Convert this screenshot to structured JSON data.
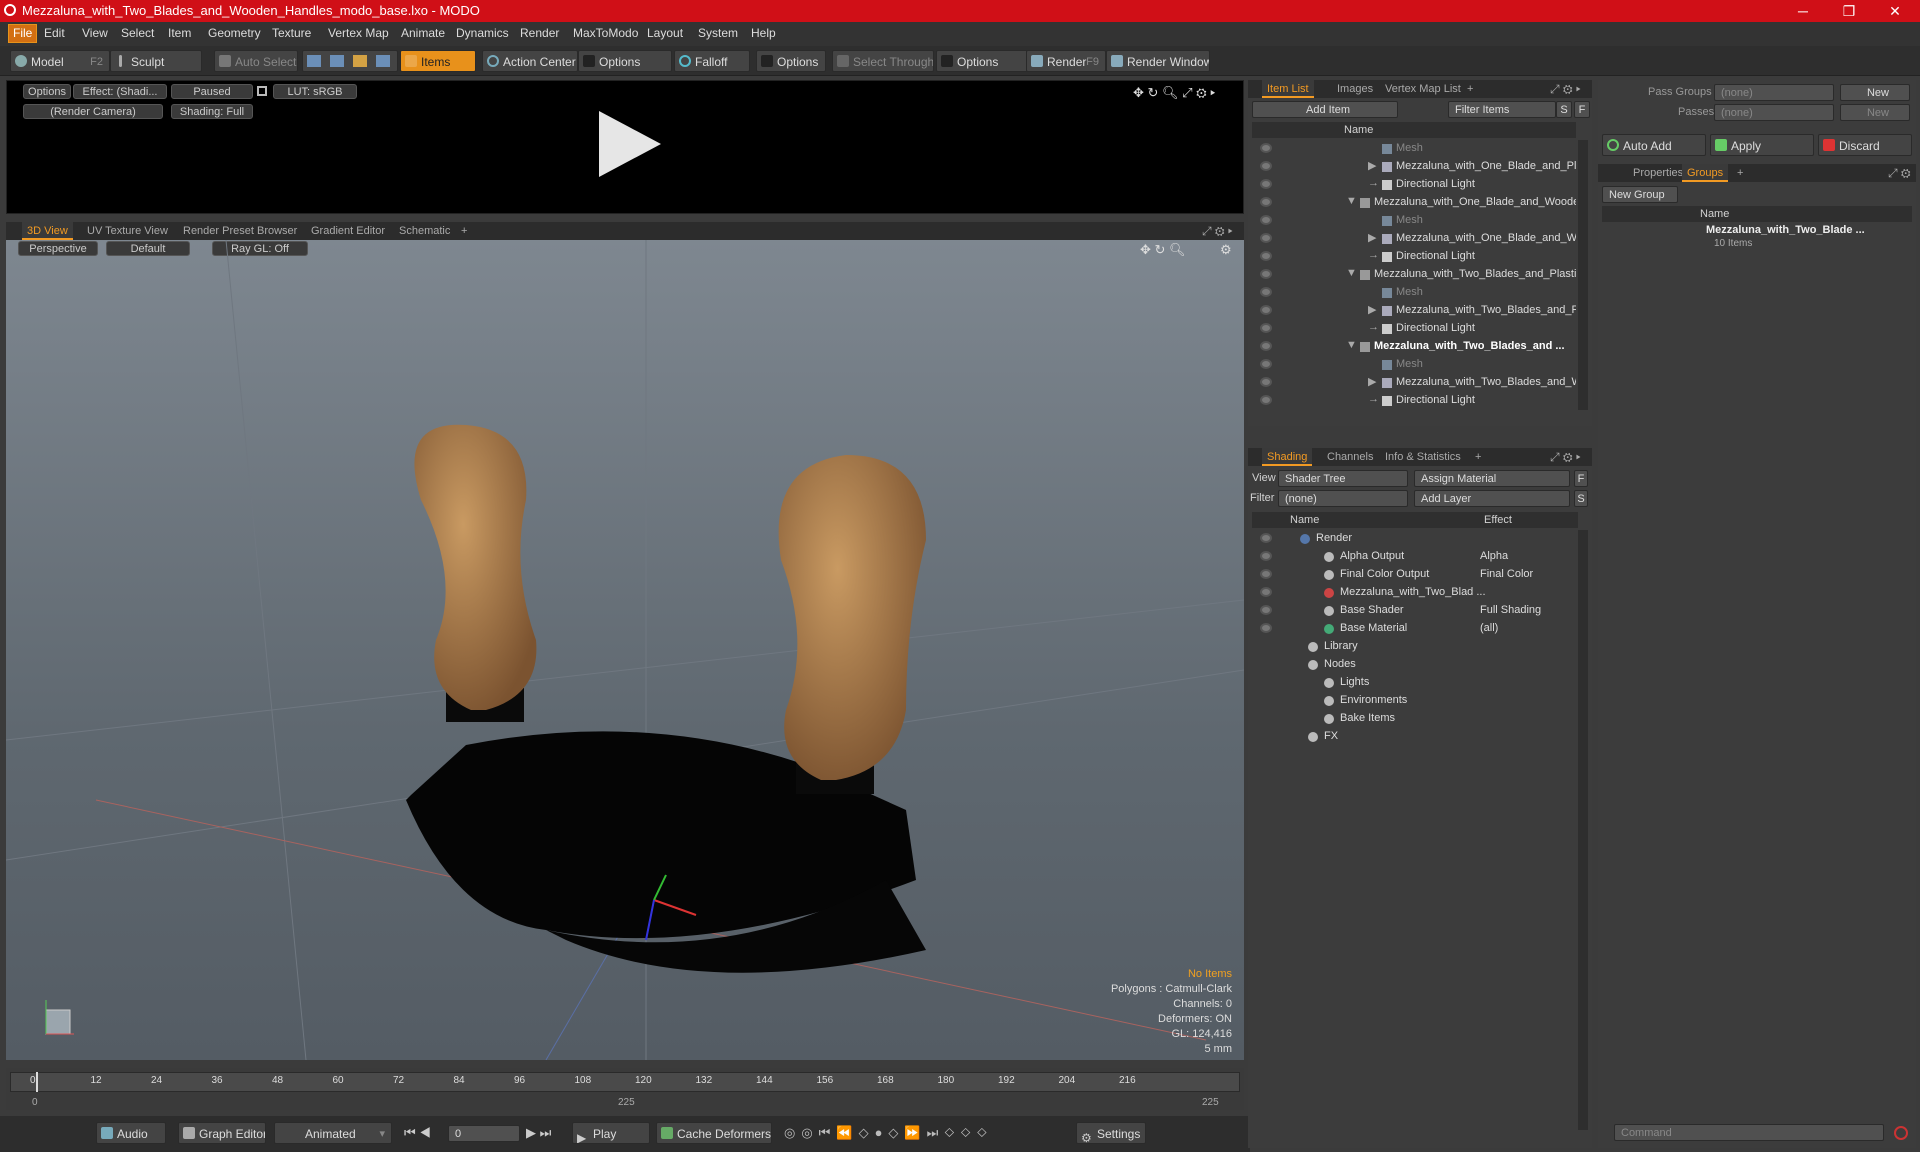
{
  "window": {
    "title": "Mezzaluna_with_Two_Blades_and_Wooden_Handles_modo_base.lxo - MODO",
    "minimize": "─",
    "maximize": "❐",
    "close": "✕"
  },
  "menus": [
    "File",
    "Edit",
    "View",
    "Select",
    "Item",
    "Geometry",
    "Texture",
    "Vertex Map",
    "Animate",
    "Dynamics",
    "Render",
    "MaxToModo",
    "Layout",
    "System",
    "Help"
  ],
  "toolbar": {
    "model": "Model",
    "model_key": "F2",
    "sculpt": "Sculpt",
    "auto_select": "Auto Select",
    "items": "Items",
    "action_center": "Action Center",
    "options1": "Options",
    "falloff": "Falloff",
    "options2": "Options",
    "select_through": "Select Through",
    "options3": "Options",
    "render": "Render",
    "render_key": "F9",
    "render_window": "Render Window"
  },
  "preview": {
    "options": "Options",
    "effect": "Effect: (Shadi...",
    "paused": "Paused",
    "lut": "LUT: sRGB",
    "camera": "(Render Camera)",
    "shading": "Shading: Full"
  },
  "viewtabs": [
    "3D View",
    "UV Texture View",
    "Render Preset Browser",
    "Gradient Editor",
    "Schematic",
    "+"
  ],
  "viewport": {
    "perspective": "Perspective",
    "default": "Default",
    "raygl": "Ray GL: Off",
    "no_items": "No Items",
    "polygons": "Polygons : Catmull-Clark",
    "channels": "Channels: 0",
    "deformers": "Deformers: ON",
    "gl": "GL: 124,416",
    "unit": "5 mm"
  },
  "timeline": {
    "ticks": [
      "0",
      "12",
      "24",
      "36",
      "48",
      "60",
      "72",
      "84",
      "96",
      "108",
      "120",
      "132",
      "144",
      "156",
      "168",
      "180",
      "192",
      "204",
      "216"
    ],
    "start": "0",
    "mid": "225",
    "end": "225"
  },
  "transport": {
    "audio": "Audio",
    "graph_editor": "Graph Editor",
    "animated": "Animated",
    "frame": "0",
    "play": "Play",
    "cache": "Cache Deformers",
    "settings": "Settings"
  },
  "itemlist": {
    "tabs": [
      "Item List",
      "Images",
      "Vertex Map List",
      "+"
    ],
    "add_item": "Add Item",
    "filter": "Filter Items",
    "s": "S",
    "f": "F",
    "col_name": "Name",
    "rows": [
      {
        "label": "Mesh",
        "indent": 2,
        "kind": "mesh"
      },
      {
        "label": "Mezzaluna_with_One_Blade_and_Plas ...",
        "indent": 1,
        "kind": "locator"
      },
      {
        "label": "Directional Light",
        "indent": 1,
        "kind": "light"
      },
      {
        "label": "Mezzaluna_with_One_Blade_and_Woode...",
        "indent": 0,
        "kind": "scene"
      },
      {
        "label": "Mesh",
        "indent": 2,
        "kind": "mesh"
      },
      {
        "label": "Mezzaluna_with_One_Blade_and_Woo...",
        "indent": 1,
        "kind": "locator"
      },
      {
        "label": "Directional Light",
        "indent": 1,
        "kind": "light"
      },
      {
        "label": "Mezzaluna_with_Two_Blades_and_Plastic...",
        "indent": 0,
        "kind": "scene"
      },
      {
        "label": "Mesh",
        "indent": 2,
        "kind": "mesh"
      },
      {
        "label": "Mezzaluna_with_Two_Blades_and_Pla ...",
        "indent": 1,
        "kind": "locator"
      },
      {
        "label": "Directional Light",
        "indent": 1,
        "kind": "light"
      },
      {
        "label": "Mezzaluna_with_Two_Blades_and ...",
        "indent": 0,
        "kind": "scene",
        "bold": true
      },
      {
        "label": "Mesh",
        "indent": 2,
        "kind": "mesh"
      },
      {
        "label": "Mezzaluna_with_Two_Blades_and_Wo...",
        "indent": 1,
        "kind": "locator"
      },
      {
        "label": "Directional Light",
        "indent": 1,
        "kind": "light"
      }
    ]
  },
  "shading": {
    "tabs": [
      "Shading",
      "Channels",
      "Info & Statistics",
      "+"
    ],
    "view_label": "View",
    "view_value": "Shader Tree",
    "assign": "Assign Material",
    "filter_label": "Filter",
    "filter_value": "(none)",
    "add_layer": "Add Layer",
    "f": "F",
    "s": "S",
    "col_name": "Name",
    "col_effect": "Effect",
    "rows": [
      {
        "label": "Render",
        "effect": "",
        "indent": 0
      },
      {
        "label": "Alpha Output",
        "effect": "Alpha",
        "indent": 1
      },
      {
        "label": "Final Color Output",
        "effect": "Final Color",
        "indent": 1
      },
      {
        "label": "Mezzaluna_with_Two_Blad ...",
        "effect": "",
        "indent": 1
      },
      {
        "label": "Base Shader",
        "effect": "Full Shading",
        "indent": 1
      },
      {
        "label": "Base Material",
        "effect": "(all)",
        "indent": 1
      },
      {
        "label": "Library",
        "effect": "",
        "indent": 2
      },
      {
        "label": "Nodes",
        "effect": "",
        "indent": 2
      },
      {
        "label": "Lights",
        "effect": "",
        "indent": 1
      },
      {
        "label": "Environments",
        "effect": "",
        "indent": 1
      },
      {
        "label": "Bake Items",
        "effect": "",
        "indent": 1
      },
      {
        "label": "FX",
        "effect": "",
        "indent": 2
      }
    ]
  },
  "groups": {
    "pass_groups": "Pass Groups",
    "passes": "Passes",
    "none1": "(none)",
    "none2": "(none)",
    "new1": "New",
    "new2": "New",
    "auto_add": "Auto Add",
    "apply": "Apply",
    "discard": "Discard",
    "tabs": [
      "Properties",
      "Groups",
      "+"
    ],
    "new_group": "New Group",
    "col_name": "Name",
    "item": "Mezzaluna_with_Two_Blade ...",
    "count": "10 Items"
  },
  "command": {
    "placeholder": "Command"
  },
  "colors": {
    "accent": "#f29a23",
    "title": "#d00f17"
  }
}
